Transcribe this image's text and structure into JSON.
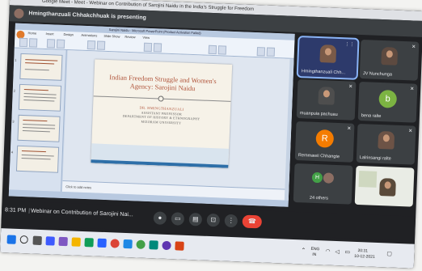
{
  "browser": {
    "tab_title": "Google Meet - Meet - Webinar on Contribution of Sarojini Naidu in the India's Struggle for Freedom"
  },
  "presenting_banner": {
    "text": "Hmingthanzuali Chhakchhuak is presenting"
  },
  "powerpoint": {
    "window_title": "Sarojini Naidu - Microsoft PowerPoint (Product Activation Failed)",
    "ribbon_tabs": [
      "Home",
      "Insert",
      "Design",
      "Animations",
      "Slide Show",
      "Review",
      "View"
    ],
    "notes_placeholder": "Click to add notes",
    "slide": {
      "title": "Indian Freedom Struggle and Women's Agency: Sarojini Naidu",
      "author_name": "DR. HMINGTHANZUALI",
      "author_role": "ASSISTANT PROFESSOR",
      "department": "DEPARTMENT OF HISTORY & ETHNOGRAPHY",
      "university": "MIZORAM UNIVERSITY"
    },
    "thumb_numbers": [
      "1",
      "2",
      "3",
      "4"
    ]
  },
  "participants": [
    {
      "name": "Hmingthanzuali Chh...",
      "kind": "video",
      "active": true
    },
    {
      "name": "JV Nunchunga",
      "kind": "video"
    },
    {
      "name": "muanpuia pachuau",
      "kind": "video"
    },
    {
      "name": "bena ralte",
      "kind": "avatar",
      "initial": "b",
      "color": "#7cb342"
    },
    {
      "name": "Remmawii Chhangte",
      "kind": "avatar",
      "initial": "R",
      "color": "#f57c00"
    },
    {
      "name": "Lalrinsangi ralte",
      "kind": "video"
    },
    {
      "name": "24 others",
      "kind": "others",
      "initial": "H",
      "color": "#43a047"
    },
    {
      "name": "",
      "kind": "self"
    }
  ],
  "meeting": {
    "time": "8:31 PM",
    "separator": "|",
    "title": "Webinar on Contribution of Sarojini Nai..."
  },
  "taskbar": {
    "lang_top": "ENG",
    "lang_bottom": "IN",
    "clock": "20:31",
    "date": "10-12-2021"
  },
  "colors": {
    "meet_bg": "#202124",
    "tile_bg": "#3c4043",
    "end_call": "#ea4335",
    "active_outline": "#8ab4f8",
    "slide_title": "#b0543a"
  }
}
